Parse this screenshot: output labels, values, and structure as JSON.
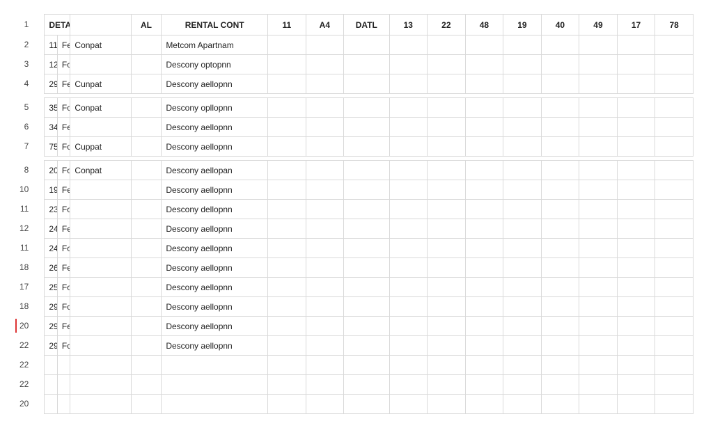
{
  "headers": {
    "detail": "DETAIL",
    "col2": "",
    "al": "AL",
    "rental": "RENTAL CONT",
    "n": [
      "11",
      "A4",
      "DATL",
      "13",
      "22",
      "48",
      "19",
      "40",
      "49",
      "17",
      "78"
    ]
  },
  "rownums": [
    "1",
    "2",
    "3",
    "4",
    "",
    "5",
    "6",
    "7",
    "",
    "8",
    "10",
    "11",
    "12",
    "11",
    "18",
    "17",
    "18",
    "20",
    "22",
    "22",
    "22",
    "20"
  ],
  "activeRowIndex": 17,
  "groups": [
    [
      {
        "a": "11",
        "b": "Fercel",
        "c": "Conpat",
        "d": "",
        "e": "Metcom Apartnam"
      },
      {
        "a": "12",
        "b": "Fortıal",
        "c": "",
        "d": "",
        "e": "Descony optopnn"
      },
      {
        "a": "29",
        "b": "Fertıal",
        "c": "Cunpat",
        "d": "",
        "e": "Descony aellopnn"
      }
    ],
    [
      {
        "a": "35",
        "b": "Fortıel",
        "c": "Conpat",
        "d": "",
        "e": "Descony opllopnn"
      },
      {
        "a": "34",
        "b": "Fertıel",
        "c": "",
        "d": "",
        "e": "Descony aellopnn"
      },
      {
        "a": "75",
        "b": "Fortıel",
        "c": "Cuppat",
        "d": "",
        "e": "Descony aellopnn"
      }
    ],
    [
      {
        "a": "20",
        "b": "Forıal",
        "c": "Conpat",
        "d": "",
        "e": "Descony aellopan"
      },
      {
        "a": "19",
        "b": "Fertıal",
        "c": "",
        "d": "",
        "e": "Descony aellopnn"
      },
      {
        "a": "23",
        "b": "Forıal",
        "c": "",
        "d": "",
        "e": "Descony dellopnn"
      },
      {
        "a": "24",
        "b": "Fertıel",
        "c": "",
        "d": "",
        "e": "Descony aellopnn"
      },
      {
        "a": "24",
        "b": "Forcel",
        "c": "",
        "d": "",
        "e": "Descony aellopnn"
      },
      {
        "a": "26",
        "b": "Ferıel",
        "c": "",
        "d": "",
        "e": "Descony aellopnn"
      },
      {
        "a": "25",
        "b": "Forıal",
        "c": "",
        "d": "",
        "e": "Descony aellopnn"
      },
      {
        "a": "29",
        "b": "Fortıel",
        "c": "",
        "d": "",
        "e": "Descony aellopnn"
      },
      {
        "a": "29",
        "b": "Ferıel",
        "c": "",
        "d": "",
        "e": "Descony aellopnn"
      },
      {
        "a": "29",
        "b": "Forıal",
        "c": "",
        "d": "",
        "e": "Descony aellopnn"
      },
      {
        "a": "",
        "b": "",
        "c": "",
        "d": "",
        "e": ""
      },
      {
        "a": "",
        "b": "",
        "c": "",
        "d": "",
        "e": ""
      },
      {
        "a": "",
        "b": "",
        "c": "",
        "d": "",
        "e": ""
      }
    ]
  ]
}
